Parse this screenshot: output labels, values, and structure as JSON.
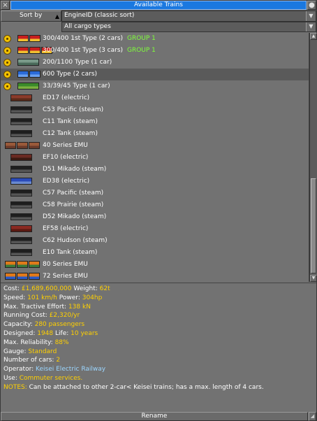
{
  "window": {
    "title": "Available Trains",
    "close_glyph": "×",
    "sticky_glyph": "●"
  },
  "sort": {
    "label": "Sort by",
    "arrow": "▲",
    "criterion": "EngineID (classic sort)",
    "dropdown_glyph": "▼"
  },
  "cargo_filter": {
    "value": "All cargo types",
    "dropdown_glyph": "▼"
  },
  "trains": [
    {
      "name": "300/400 1st Type (2 cars)",
      "group": "GROUP 1",
      "badge": true,
      "colors": [
        "#c81e1e",
        "#f0c030"
      ],
      "cars": 2
    },
    {
      "name": "300/400 1st Type (3 cars)",
      "group": "GROUP 1",
      "badge": true,
      "colors": [
        "#c81e1e",
        "#f0c030"
      ],
      "cars": 3
    },
    {
      "name": "200/1100 Type (1 car)",
      "group": "",
      "badge": true,
      "colors": [
        "#7a9a8a",
        "#4a6a5a"
      ],
      "cars": 1
    },
    {
      "name": "600 Type (2 cars)",
      "group": "",
      "badge": true,
      "selected": true,
      "colors": [
        "#2a6ad8",
        "#6aa0f0"
      ],
      "cars": 2
    },
    {
      "name": "33/39/45 Type (1 car)",
      "group": "",
      "badge": true,
      "colors": [
        "#3a8a2a",
        "#7ab040"
      ],
      "cars": 1
    },
    {
      "name": "ED17 (electric)",
      "group": "",
      "colors": [
        "#8a3a2a",
        "#5a2a1a"
      ],
      "cars": 1
    },
    {
      "name": "C53 Pacific (steam)",
      "group": "",
      "colors": [
        "#1e1e1e",
        "#555555"
      ],
      "cars": 1
    },
    {
      "name": "C11 Tank (steam)",
      "group": "",
      "colors": [
        "#1e1e1e",
        "#555555"
      ],
      "cars": 1
    },
    {
      "name": "C12 Tank (steam)",
      "group": "",
      "colors": [
        "#1e1e1e",
        "#555555"
      ],
      "cars": 1
    },
    {
      "name": "40 Series EMU",
      "group": "",
      "colors": [
        "#9a5a3a",
        "#6a3a2a"
      ],
      "cars": 3
    },
    {
      "name": "EF10 (electric)",
      "group": "",
      "colors": [
        "#6a2a22",
        "#3a1a12"
      ],
      "cars": 1
    },
    {
      "name": "D51 Mikado (steam)",
      "group": "",
      "colors": [
        "#1e1e1e",
        "#555555"
      ],
      "cars": 1
    },
    {
      "name": "ED38 (electric)",
      "group": "",
      "colors": [
        "#2a4ab8",
        "#6a8ad0"
      ],
      "cars": 1
    },
    {
      "name": "C57 Pacific (steam)",
      "group": "",
      "colors": [
        "#1e1e1e",
        "#555555"
      ],
      "cars": 1
    },
    {
      "name": "C58 Prairie (steam)",
      "group": "",
      "colors": [
        "#1e1e1e",
        "#555555"
      ],
      "cars": 1
    },
    {
      "name": "D52 Mikado (steam)",
      "group": "",
      "colors": [
        "#1e1e1e",
        "#555555"
      ],
      "cars": 1
    },
    {
      "name": "EF58 (electric)",
      "group": "",
      "colors": [
        "#8a2a22",
        "#5a1a12"
      ],
      "cars": 1
    },
    {
      "name": "C62 Hudson (steam)",
      "group": "",
      "colors": [
        "#1e1e1e",
        "#555555"
      ],
      "cars": 1
    },
    {
      "name": "E10 Tank (steam)",
      "group": "",
      "colors": [
        "#1e1e1e",
        "#555555"
      ],
      "cars": 1
    },
    {
      "name": "80 Series EMU",
      "group": "",
      "colors": [
        "#e07a1a",
        "#3a7a3a"
      ],
      "cars": 3
    },
    {
      "name": "72 Series EMU",
      "group": "",
      "colors": [
        "#e07a1a",
        "#2a5ac8"
      ],
      "cars": 3
    }
  ],
  "details": {
    "cost_label": "Cost:",
    "cost": "£1,689,600,000",
    "weight_label": "Weight:",
    "weight": "62t",
    "speed_label": "Speed:",
    "speed": "101 km/h",
    "power_label": "Power:",
    "power": "304hp",
    "tractive_label": "Max. Tractive Effort:",
    "tractive": "138 kN",
    "running_label": "Running Cost:",
    "running": "£2,320/yr",
    "capacity_label": "Capacity:",
    "capacity": "280 passengers",
    "designed_label": "Designed:",
    "designed": "1948",
    "life_label": "Life:",
    "life": "10 years",
    "reliability_label": "Max. Reliability:",
    "reliability": "88%",
    "gauge_label": "Gauge:",
    "gauge": "Standard",
    "cars_label": "Number of cars:",
    "cars": "2",
    "operator_label": "Operator:",
    "operator": "Keisei Electric Railway",
    "use_label": "Use:",
    "use": "Commuter services.",
    "notes_label": "NOTES:",
    "notes": "Can be attached to other 2-car< Keisei trains; has a max. length of 4 cars."
  },
  "footer": {
    "rename": "Rename",
    "resize_glyph": "◢"
  },
  "colors": {
    "title_bar": "#1a78e0",
    "value_yellow": "#ffd000",
    "group_green": "#7fff3a",
    "operator_blue": "#9bd6ff"
  }
}
